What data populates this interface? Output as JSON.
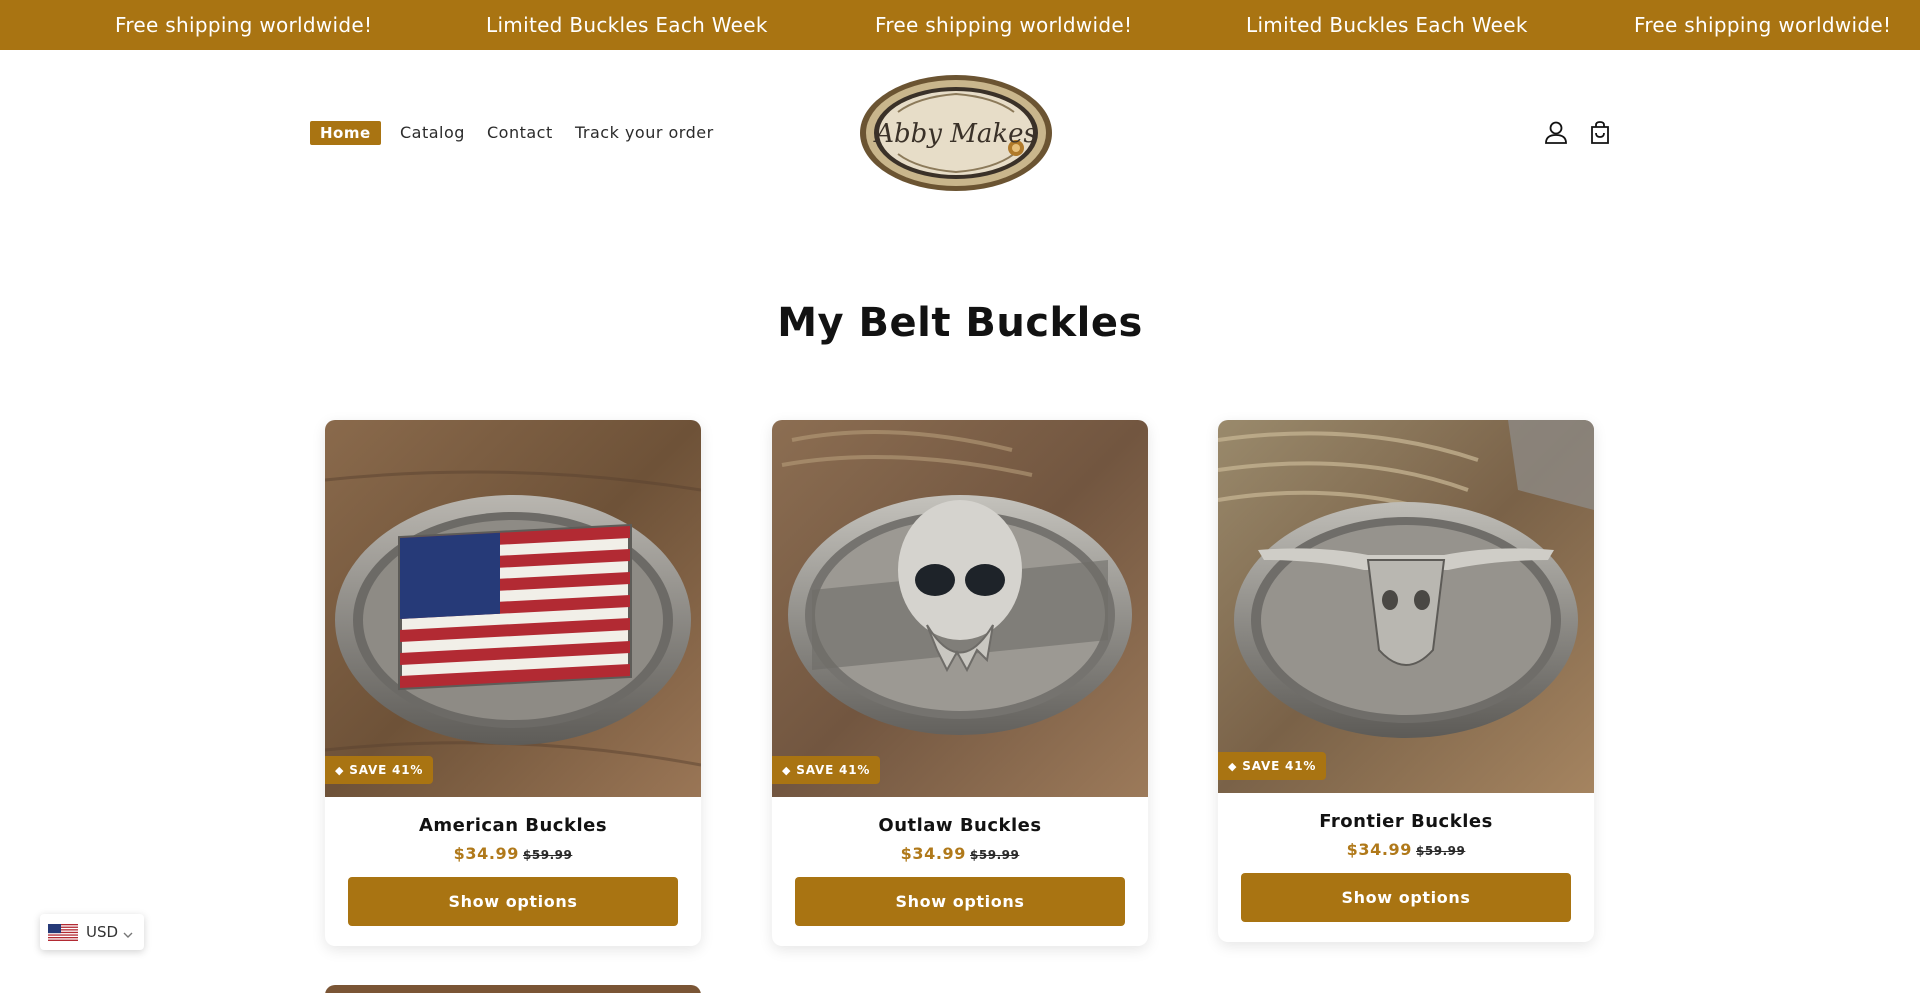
{
  "announcement": {
    "messages": [
      "Free shipping worldwide!",
      "Limited Buckles Each Week",
      "Free shipping worldwide!",
      "Limited Buckles Each Week",
      "Free shipping worldwide!"
    ]
  },
  "header": {
    "nav": [
      {
        "label": "Home"
      },
      {
        "label": "Catalog"
      },
      {
        "label": "Contact"
      },
      {
        "label": "Track your order"
      }
    ],
    "logo_text": "Abby Makes",
    "icons": [
      "account-icon",
      "cart-icon"
    ]
  },
  "section": {
    "title": "My Belt Buckles"
  },
  "products": [
    {
      "name": "American Buckles",
      "badge": "SAVE 41%",
      "price": "$34.99",
      "compare_price": "$59.99",
      "button": "Show options"
    },
    {
      "name": "Outlaw Buckles",
      "badge": "SAVE 41%",
      "price": "$34.99",
      "compare_price": "$59.99",
      "button": "Show options"
    },
    {
      "name": "Frontier Buckles",
      "badge": "SAVE 41%",
      "price": "$34.99",
      "compare_price": "$59.99",
      "button": "Show options"
    }
  ],
  "currency": {
    "code": "USD",
    "flag": "us-flag-icon"
  },
  "colors": {
    "accent": "#a97412",
    "price": "#b0791a",
    "text": "#121212"
  }
}
